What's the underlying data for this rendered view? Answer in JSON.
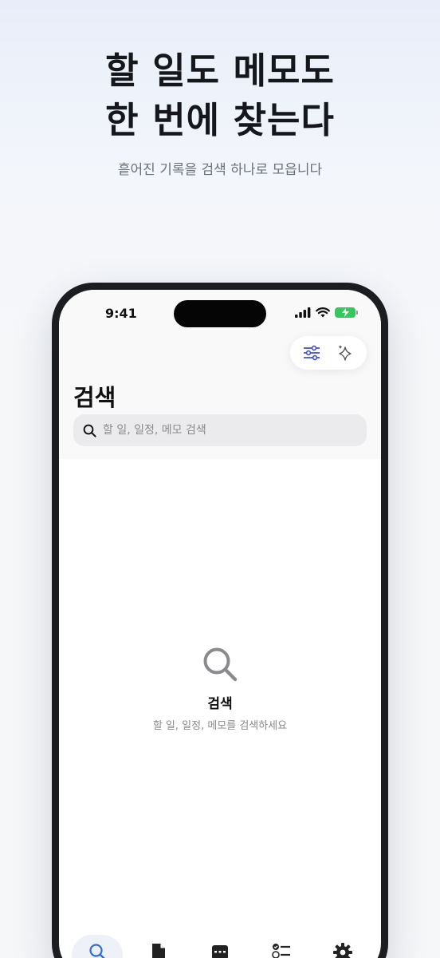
{
  "hero": {
    "headline_line1": "할 일도 메모도",
    "headline_line2": "한 번에 찾는다",
    "subheadline": "흩어진 기록을 검색 하나로 모읍니다"
  },
  "status_bar": {
    "time": "9:41"
  },
  "toolbar": {
    "filter_icon": "sliders-icon",
    "ai_icon": "sparkles-icon"
  },
  "page": {
    "title": "검색"
  },
  "search": {
    "placeholder": "할 일, 일정, 메모 검색",
    "value": ""
  },
  "empty_state": {
    "icon": "magnifier-icon",
    "title": "검색",
    "subtitle": "할 일, 일정, 메모를 검색하세요"
  },
  "tab_bar": {
    "tabs": [
      {
        "icon": "search-icon",
        "active": true
      },
      {
        "icon": "document-icon",
        "active": false
      },
      {
        "icon": "calendar-icon",
        "active": false
      },
      {
        "icon": "checklist-icon",
        "active": false
      },
      {
        "icon": "gear-icon",
        "active": false
      }
    ]
  },
  "colors": {
    "accent": "#3f51c8",
    "battery": "#34c759",
    "text_primary": "#111111",
    "text_secondary": "#8a8a8e"
  }
}
